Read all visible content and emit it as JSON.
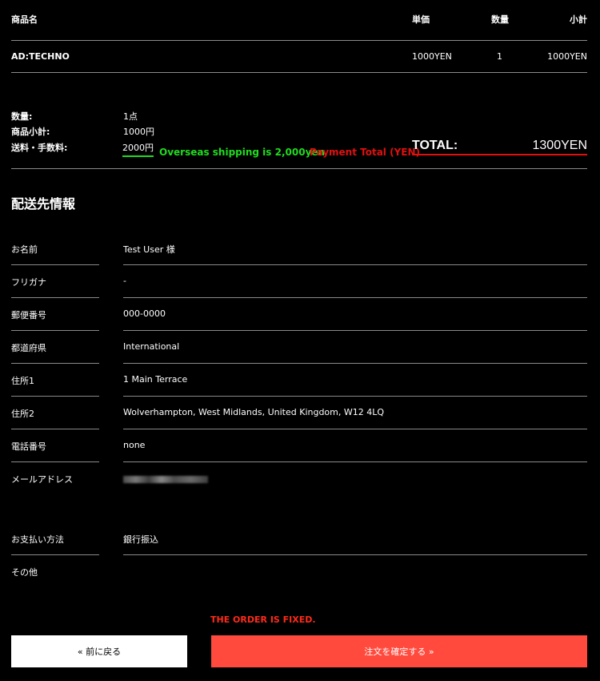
{
  "cart": {
    "headers": {
      "name": "商品名",
      "unit_price": "単価",
      "qty": "数量",
      "subtotal": "小計"
    },
    "items": [
      {
        "name": "AD:TECHNO",
        "unit_price": "1000YEN",
        "qty": "1",
        "subtotal": "1000YEN"
      }
    ]
  },
  "summary": {
    "qty_label": "数量:",
    "qty_value": "1点",
    "subtotal_label": "商品小計:",
    "subtotal_value": "1000円",
    "shipping_label": "送料・手数料:",
    "shipping_value": "2000円",
    "overseas_note": "Overseas shipping is 2,000yen",
    "payment_total_note": "Payment Total (YEN)",
    "total_label": "TOTAL:",
    "total_value": "1300YEN"
  },
  "shipping_info": {
    "title": "配送先情報",
    "rows": [
      {
        "label": "お名前",
        "value": "Test User 様"
      },
      {
        "label": "フリガナ",
        "value": "-"
      },
      {
        "label": "郵便番号",
        "value": "000-0000"
      },
      {
        "label": "都道府県",
        "value": "International"
      },
      {
        "label": "住所1",
        "value": "1 Main Terrace"
      },
      {
        "label": "住所2",
        "value": "Wolverhampton, West Midlands, United Kingdom, W12 4LQ"
      },
      {
        "label": "電話番号",
        "value": "none"
      },
      {
        "label": "メールアドレス",
        "value": ""
      }
    ]
  },
  "payment": {
    "rows": [
      {
        "label": "お支払い方法",
        "value": "銀行振込"
      },
      {
        "label": "その他",
        "value": ""
      }
    ]
  },
  "order_fixed": "THE ORDER IS FIXED.",
  "buttons": {
    "back": "« 前に戻る",
    "confirm": "注文を確定する »"
  },
  "colors": {
    "accent_red": "#ff4a3d",
    "green": "#1fdc1f",
    "total_underline": "#e01010"
  }
}
